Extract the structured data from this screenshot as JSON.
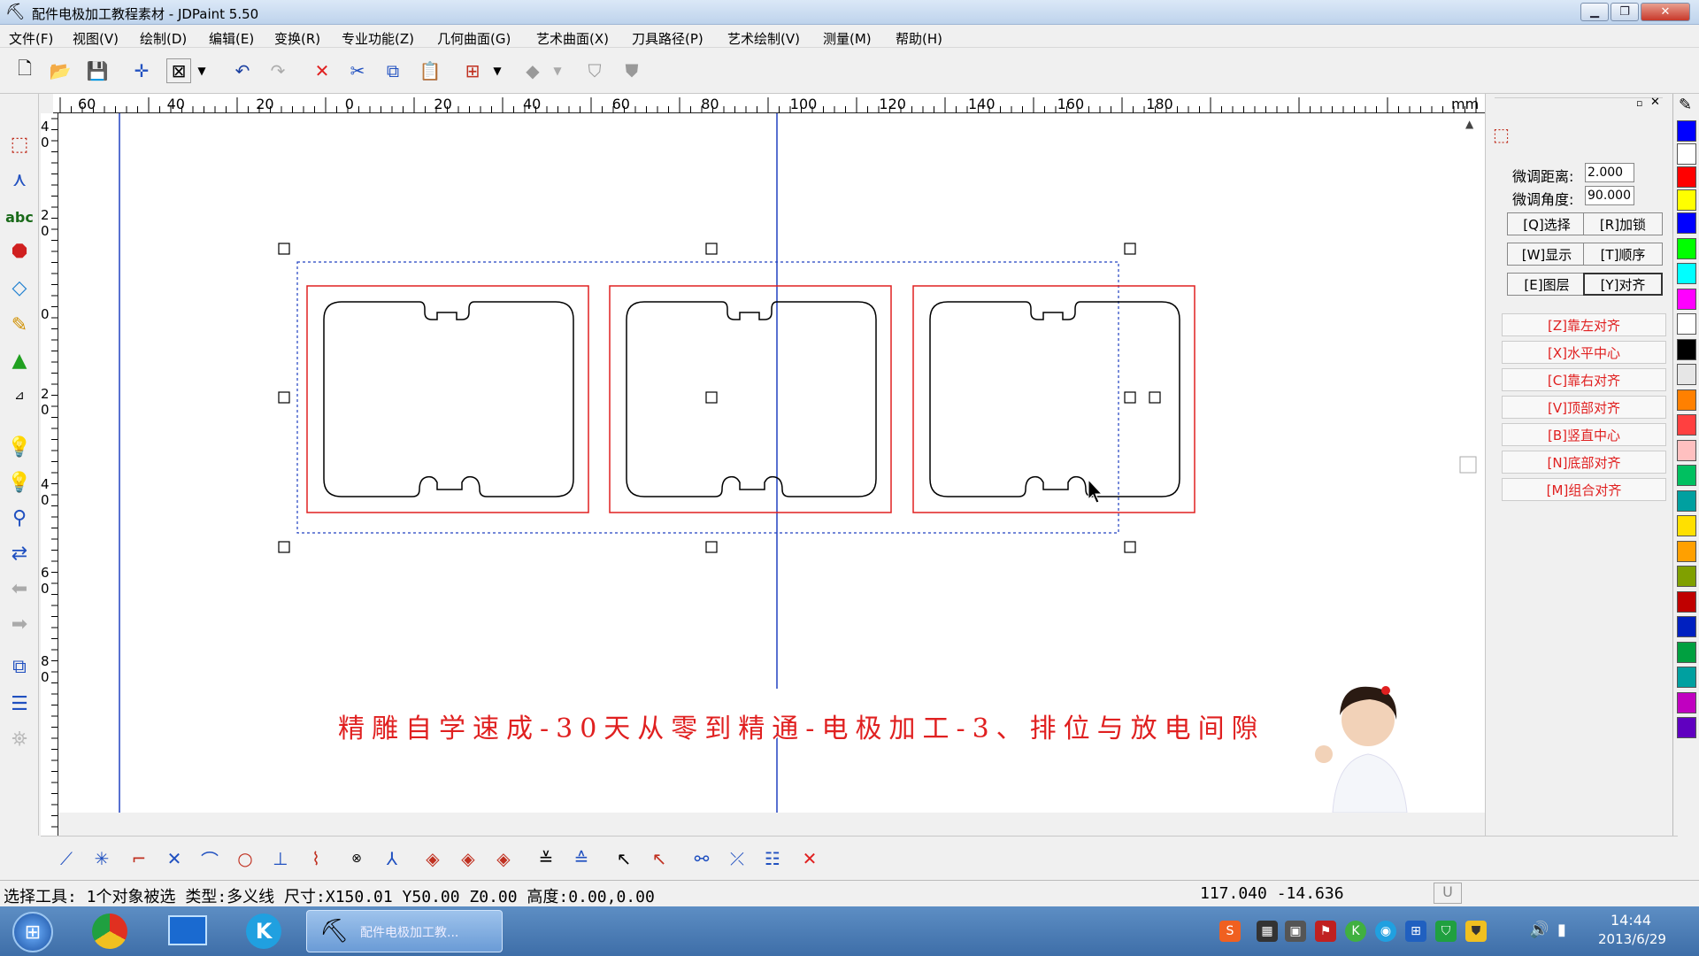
{
  "window": {
    "title": "配件电极加工教程素材 - JDPaint 5.50"
  },
  "menu": [
    "文件(F)",
    "视图(V)",
    "绘制(D)",
    "编辑(E)",
    "变换(R)",
    "专业功能(Z)",
    "几何曲面(G)",
    "艺术曲面(X)",
    "刀具路径(P)",
    "艺术绘制(V)",
    "测量(M)",
    "帮助(H)"
  ],
  "ruler": {
    "unit": "mm",
    "top_labels": [
      "60",
      "40",
      "20",
      "0",
      "20",
      "40",
      "60",
      "80",
      "100",
      "120",
      "140",
      "160",
      "180"
    ],
    "left_labels": [
      "4\n0",
      "2\n0",
      "0",
      "2\n0",
      "4\n0",
      "6\n0",
      "8\n0"
    ]
  },
  "panel": {
    "fine_dist_label": "微调距离:",
    "fine_dist_value": "2.000",
    "fine_angle_label": "微调角度:",
    "fine_angle_value": "90.000",
    "btn_select": "[Q]选择",
    "btn_lock": "[R]加锁",
    "btn_show": "[W]显示",
    "btn_order": "[T]顺序",
    "btn_layer": "[E]图层",
    "btn_align": "[Y]对齐",
    "align": [
      "[Z]靠左对齐",
      "[X]水平中心",
      "[C]靠右对齐",
      "[V]顶部对齐",
      "[B]竖直中心",
      "[N]底部对齐",
      "[M]组合对齐"
    ]
  },
  "caption": "精雕自学速成-30天从零到精通-电极加工-3、排位与放电间隙",
  "status": {
    "text": "选择工具: 1个对象被选 类型:多义线 尺寸:X150.01 Y50.00 Z0.00 高度:0.00,0.00",
    "coords": "117.040 -14.636",
    "mode": "U"
  },
  "taskbar": {
    "active_task": "配件电极加工教...",
    "time": "14:44",
    "date": "2013/6/29"
  },
  "colors": {
    "accent_red": "#e02020",
    "blue_line": "#2040c0",
    "palette": [
      "#0000ff",
      "#ffffff",
      "#ff0000",
      "#ffff00",
      "#0000ff",
      "#00ff00",
      "#00ffff",
      "#ff00ff",
      "#ffffff",
      "#000000",
      "#e6e6e6",
      "#ff8000",
      "#ff4040",
      "#ffc0c0",
      "#00c060",
      "#00a0a0",
      "#ffe000",
      "#ffa000",
      "#80a000",
      "#c00000",
      "#0020c0",
      "#00a040",
      "#00a0a0",
      "#c000c0",
      "#6000c0"
    ]
  }
}
